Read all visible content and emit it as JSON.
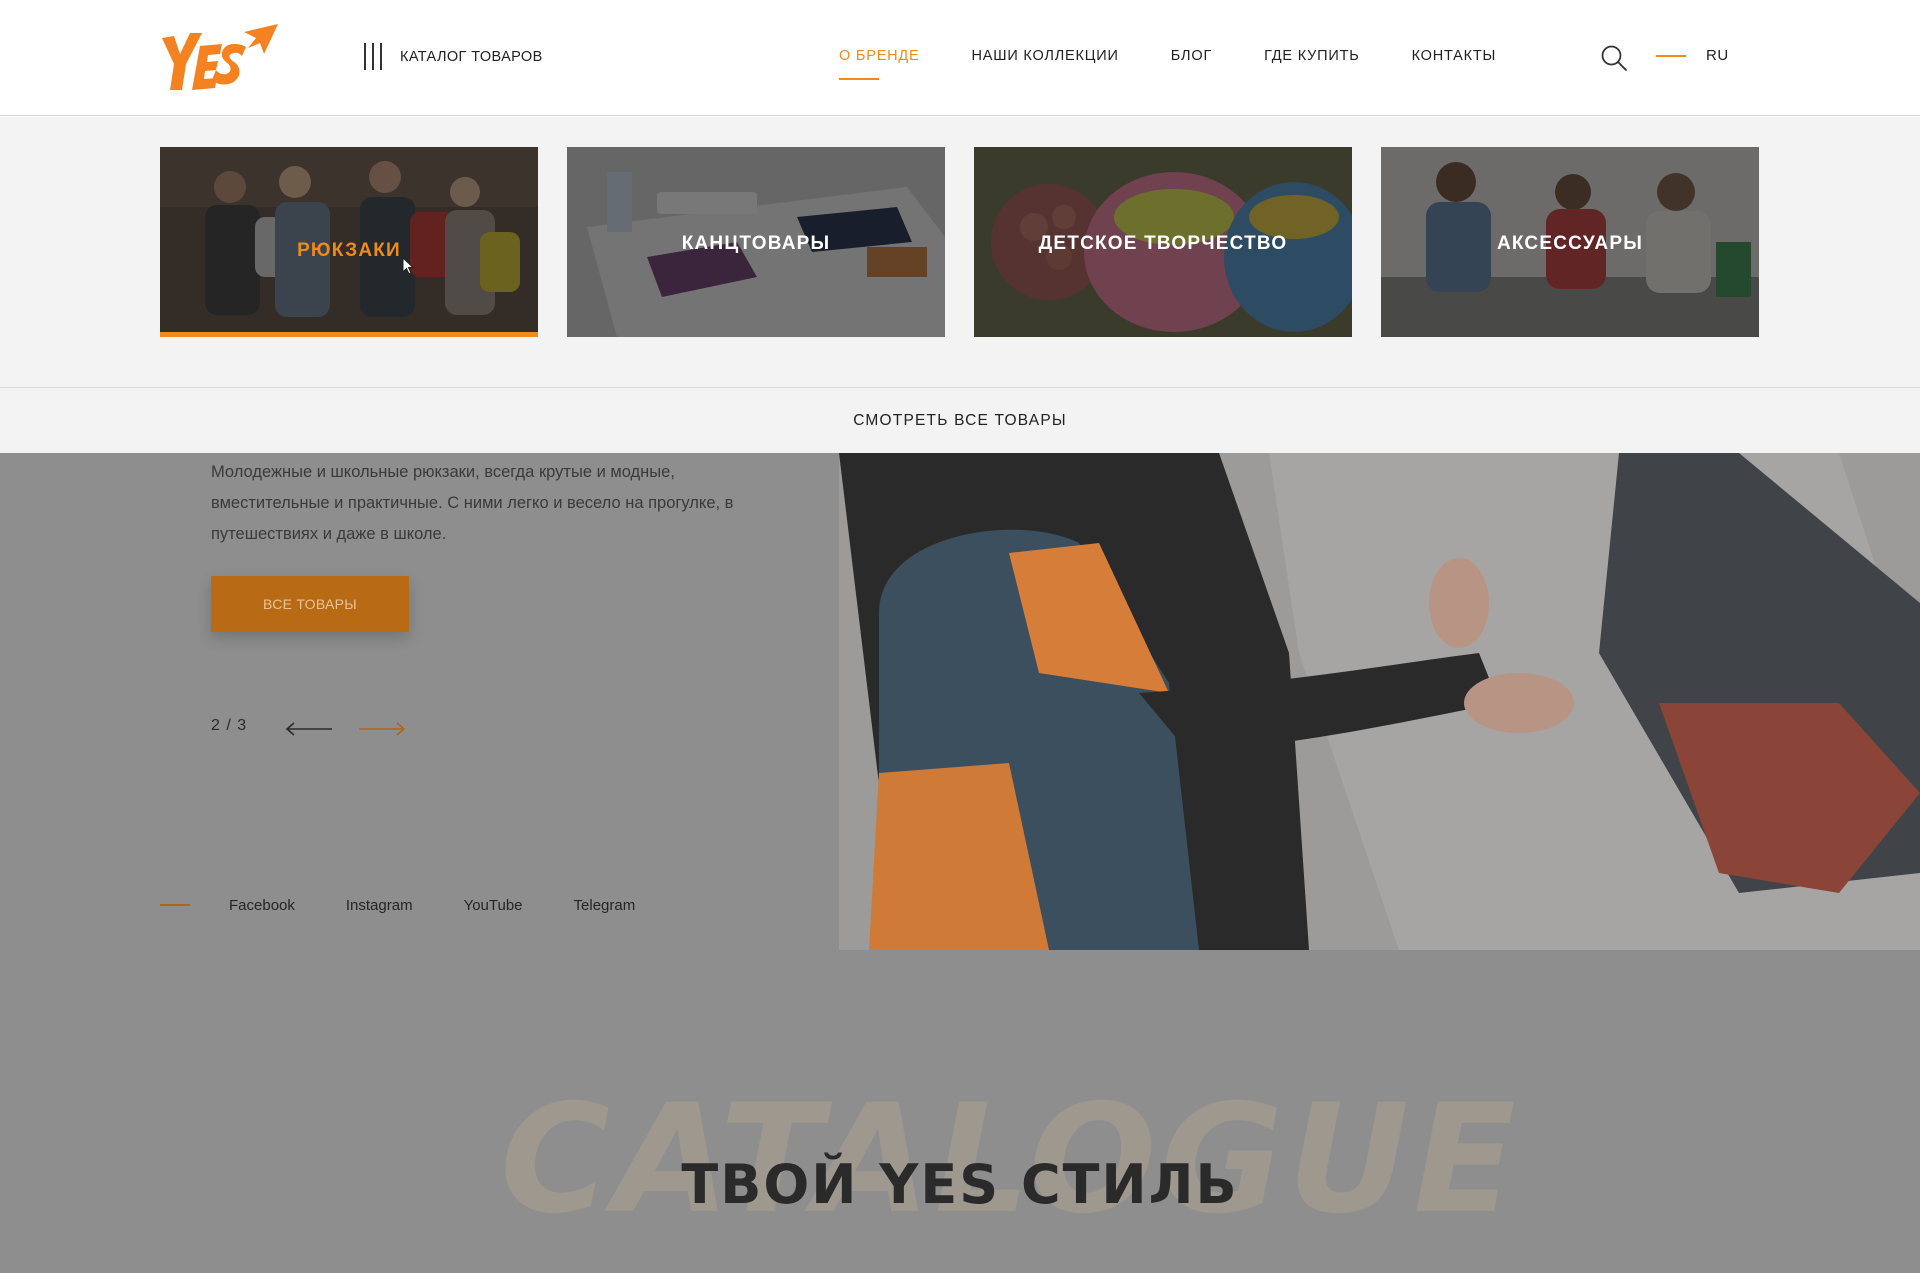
{
  "header": {
    "logo_text": "YES",
    "catalog_label": "КАТАЛОГ ТОВАРОВ",
    "nav": [
      {
        "label": "О БРЕНДЕ",
        "active": true
      },
      {
        "label": "НАШИ КОЛЛЕКЦИИ",
        "active": false
      },
      {
        "label": "БЛОГ",
        "active": false
      },
      {
        "label": "ГДЕ КУПИТЬ",
        "active": false
      },
      {
        "label": "КОНТАКТЫ",
        "active": false
      }
    ],
    "search_icon": "search-icon",
    "language": "RU"
  },
  "dropdown": {
    "cards": [
      {
        "title": "РЮКЗАКИ",
        "active": true
      },
      {
        "title": "КАНЦТОВАРЫ",
        "active": false
      },
      {
        "title": "ДЕТСКОЕ ТВОРЧЕСТВО",
        "active": false
      },
      {
        "title": "АКСЕССУАРЫ",
        "active": false
      }
    ],
    "view_all": "СМОТРЕТЬ ВСЕ ТОВАРЫ"
  },
  "hero": {
    "description": "Молодежные и школьные рюкзаки, всегда крутые и модные, вместительные и практичные. С ними легко и весело на прогулке, в путешествиях и даже в школе.",
    "button": "ВСЕ ТОВАРЫ",
    "pager": "2 / 3"
  },
  "social": [
    "Facebook",
    "Instagram",
    "YouTube",
    "Telegram"
  ],
  "section": {
    "background_word": "CATALOGUE",
    "title": "ТВОЙ YES СТИЛЬ"
  },
  "colors": {
    "accent": "#f08a1c",
    "text": "#222222",
    "panel": "#f3f3f3",
    "overlay": "#8e8e8e"
  }
}
